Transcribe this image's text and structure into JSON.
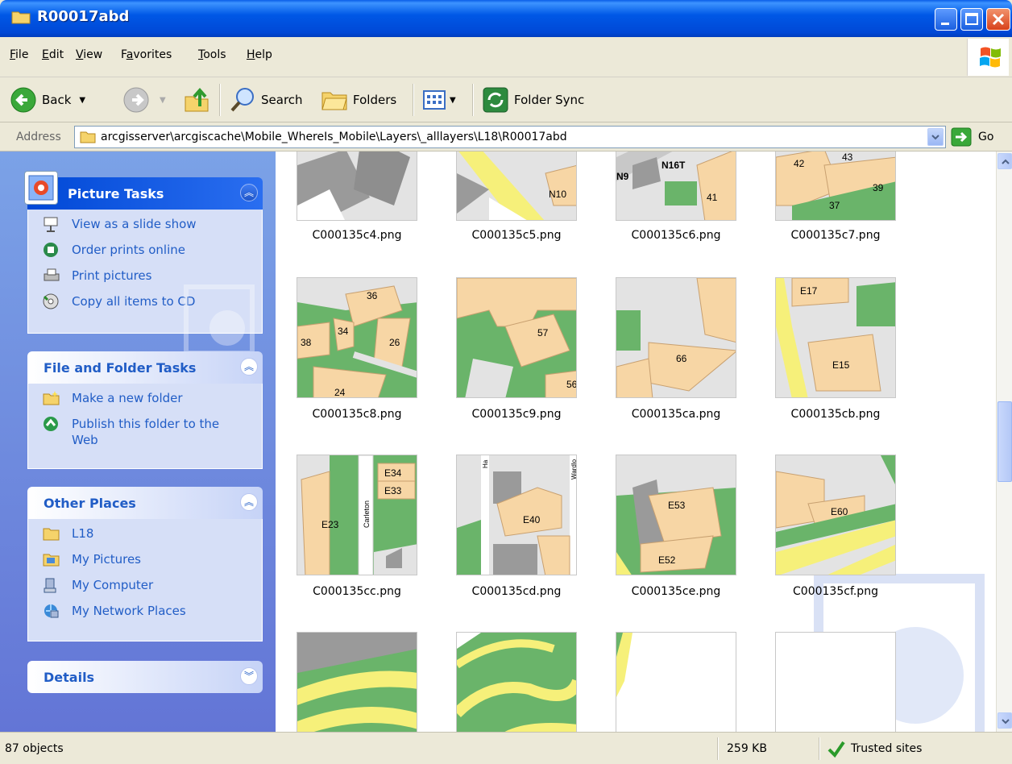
{
  "window": {
    "title": "R00017abd"
  },
  "menu": [
    {
      "label": "File",
      "key": "F",
      "rest": "ile"
    },
    {
      "label": "Edit",
      "key": "E",
      "rest": "dit"
    },
    {
      "label": "View",
      "key": "V",
      "rest": "iew"
    },
    {
      "label": "Favorites",
      "key": "a",
      "pre": "F",
      "rest": "vorites"
    },
    {
      "label": "Tools",
      "key": "T",
      "rest": "ools"
    },
    {
      "label": "Help",
      "key": "H",
      "rest": "elp"
    }
  ],
  "toolbar": {
    "back": "Back",
    "search": "Search",
    "folders": "Folders",
    "folder_sync": "Folder Sync"
  },
  "address": {
    "label": "Address",
    "path": "arcgisserver\\arcgiscache\\Mobile_WhereIs_Mobile\\Layers\\_alllayers\\L18\\R00017abd",
    "go": "Go"
  },
  "panels": {
    "picture_tasks": {
      "title": "Picture Tasks",
      "items": [
        "View as a slide show",
        "Order prints online",
        "Print pictures",
        "Copy all items to CD"
      ]
    },
    "file_folder_tasks": {
      "title": "File and Folder Tasks",
      "items": [
        "Make a new folder",
        "Publish this folder to the Web"
      ]
    },
    "other_places": {
      "title": "Other Places",
      "items": [
        "L18",
        "My Pictures",
        "My Computer",
        "My Network Places"
      ]
    },
    "details": {
      "title": "Details"
    }
  },
  "files": [
    {
      "name": "C000135c4.png",
      "labels": []
    },
    {
      "name": "C000135c5.png",
      "labels": [
        "N10"
      ]
    },
    {
      "name": "C000135c6.png",
      "labels": [
        "N16T",
        "N9",
        "41"
      ]
    },
    {
      "name": "C000135c7.png",
      "labels": [
        "42",
        "43",
        "39",
        "37"
      ]
    },
    {
      "name": "C000135c8.png",
      "labels": [
        "36",
        "38",
        "34",
        "26",
        "24"
      ]
    },
    {
      "name": "C000135c9.png",
      "labels": [
        "57",
        "56"
      ]
    },
    {
      "name": "C000135ca.png",
      "labels": [
        "66"
      ]
    },
    {
      "name": "C000135cb.png",
      "labels": [
        "E17",
        "E15"
      ]
    },
    {
      "name": "C000135cc.png",
      "labels": [
        "E34",
        "E33",
        "E23",
        "Carleton"
      ]
    },
    {
      "name": "C000135cd.png",
      "labels": [
        "E40",
        "Ha",
        "Wardlo"
      ]
    },
    {
      "name": "C000135ce.png",
      "labels": [
        "E53",
        "E52"
      ]
    },
    {
      "name": "C000135cf.png",
      "labels": [
        "E60"
      ]
    },
    {
      "name": "",
      "labels": []
    },
    {
      "name": "",
      "labels": []
    },
    {
      "name": "",
      "labels": []
    },
    {
      "name": "",
      "labels": []
    }
  ],
  "status": {
    "objects": "87 objects",
    "size": "259 KB",
    "zone": "Trusted sites"
  }
}
